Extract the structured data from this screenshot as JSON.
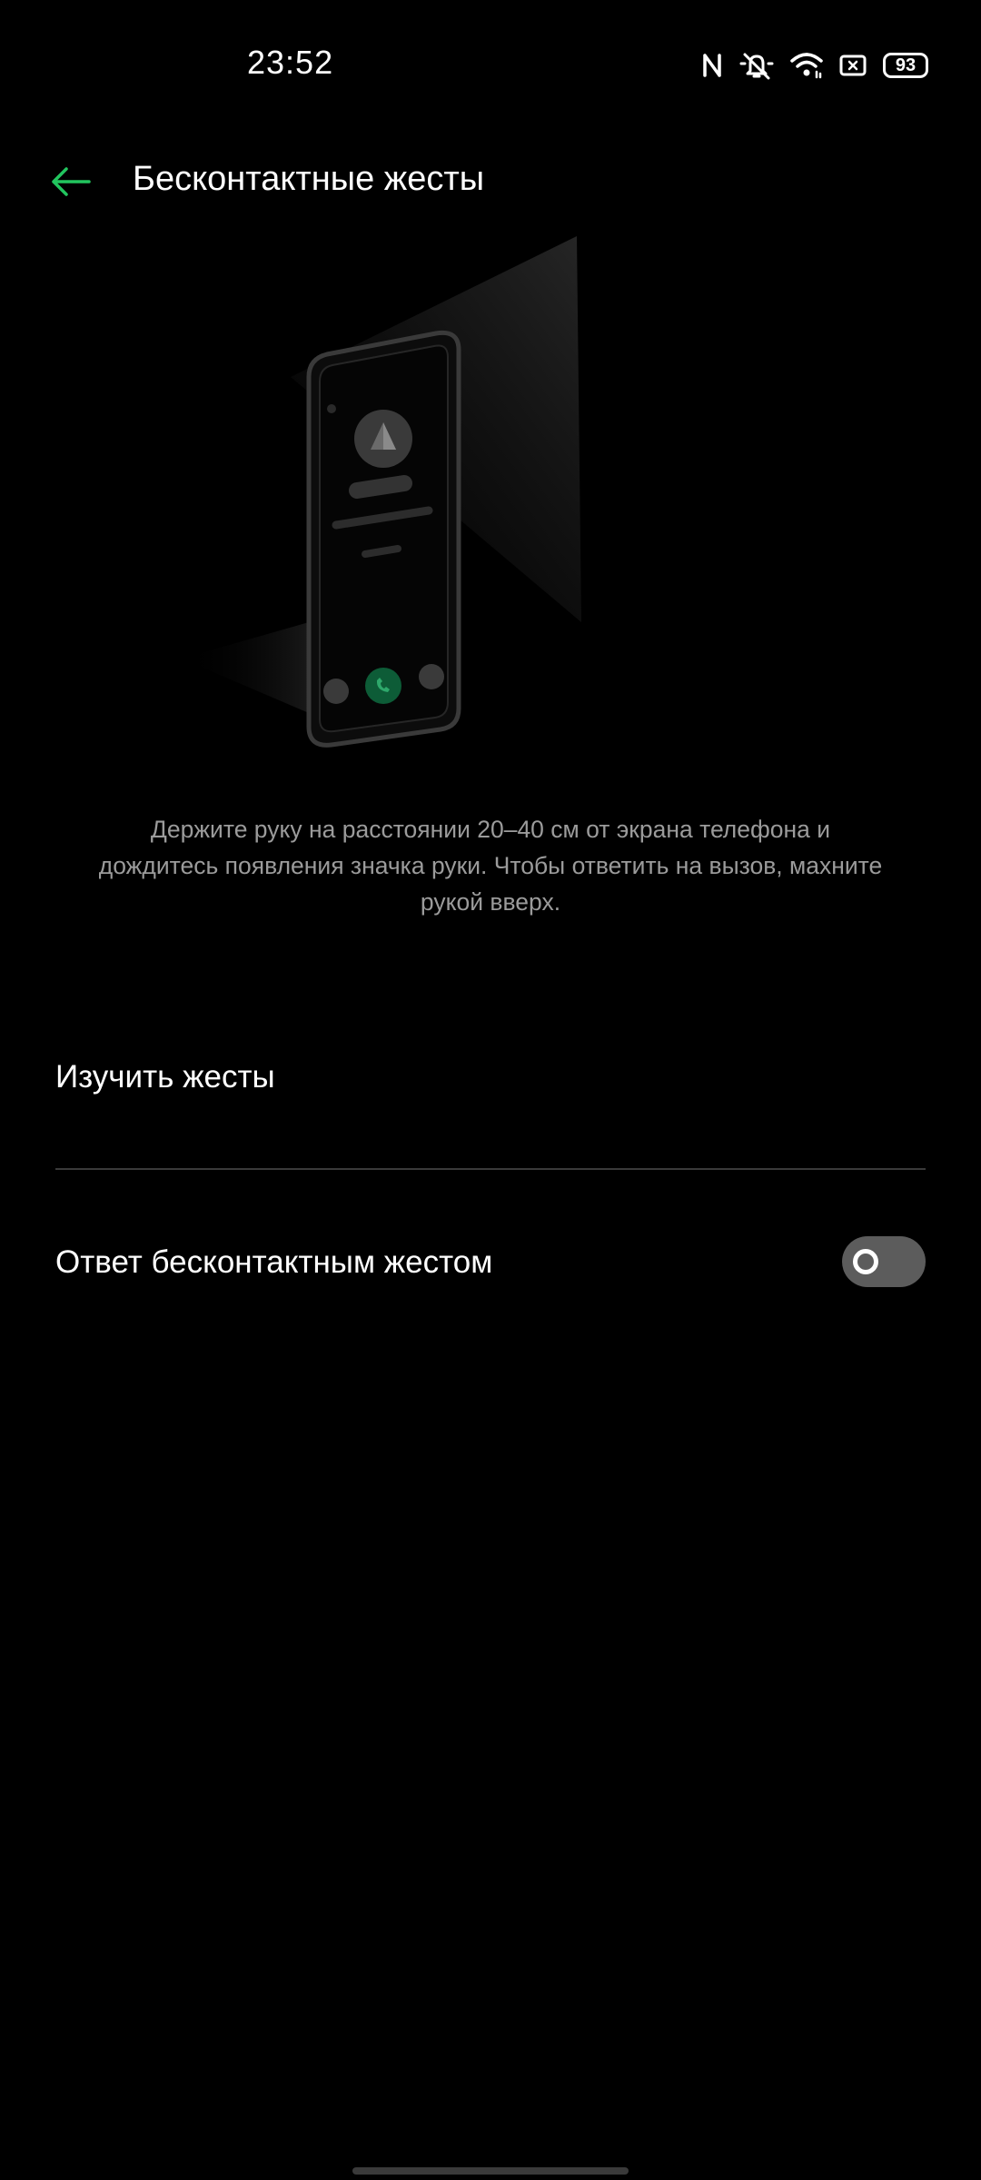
{
  "status_bar": {
    "time": "23:52",
    "battery": "93",
    "icons": [
      "nfc-icon",
      "mute-icon",
      "wifi-icon",
      "screen-record-icon",
      "battery-icon"
    ]
  },
  "header": {
    "back_icon": "arrow-left-icon",
    "title": "Бесконтактные жесты"
  },
  "illustration": {
    "description_icons": [
      "phone-illustration",
      "call-accept-icon"
    ]
  },
  "description": "Держите руку на расстоянии 20–40 см от экрана телефона и дождитесь появления значка руки. Чтобы ответить на вызов, махните рукой вверх.",
  "items": {
    "learn_gestures": "Изучить жесты",
    "answer_with_gesture": "Ответ бесконтактным жестом",
    "answer_with_gesture_enabled": false
  },
  "colors": {
    "accent": "#22c55e",
    "background": "#000000",
    "switch_off": "#5c5c5c"
  }
}
